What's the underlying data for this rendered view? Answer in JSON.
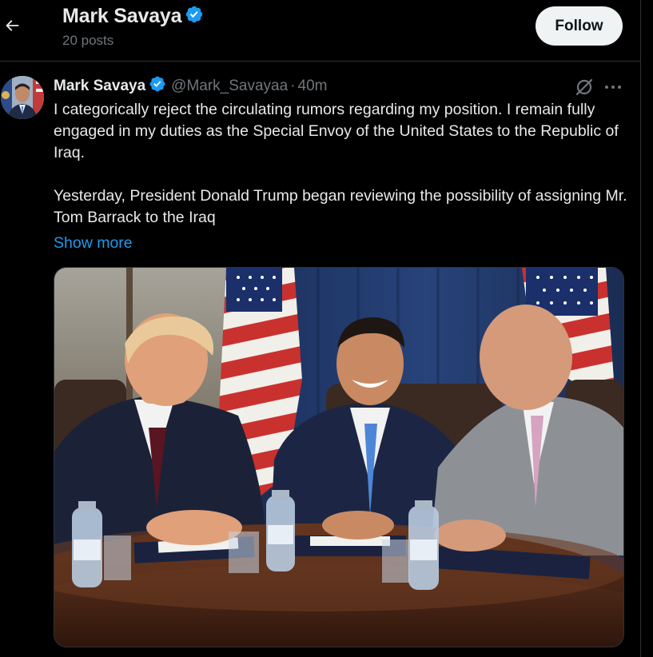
{
  "header": {
    "name": "Mark Savaya",
    "posts_count": "20 posts",
    "follow_label": "Follow"
  },
  "post": {
    "author_name": "Mark Savaya",
    "handle": "@Mark_Savayaa",
    "separator": "·",
    "time": "40m",
    "paragraph1": "I categorically reject the circulating rumors regarding my position. I remain fully engaged in my duties as the Special Envoy of the United States to the Republic of Iraq.",
    "paragraph2": "Yesterday, President Donald Trump began reviewing the possibility of assigning Mr. Tom Barrack to the Iraq",
    "show_more": "Show more"
  },
  "icons": {
    "back": "back-arrow-icon",
    "verified": "verified-badge-icon",
    "grok": "grok-icon",
    "more": "more-dots-icon"
  },
  "colors": {
    "background": "#000000",
    "text": "#e7e9ea",
    "secondary": "#71767b",
    "accent": "#1d9bf0",
    "follow_bg": "#eff3f4",
    "border": "#2f3336"
  }
}
